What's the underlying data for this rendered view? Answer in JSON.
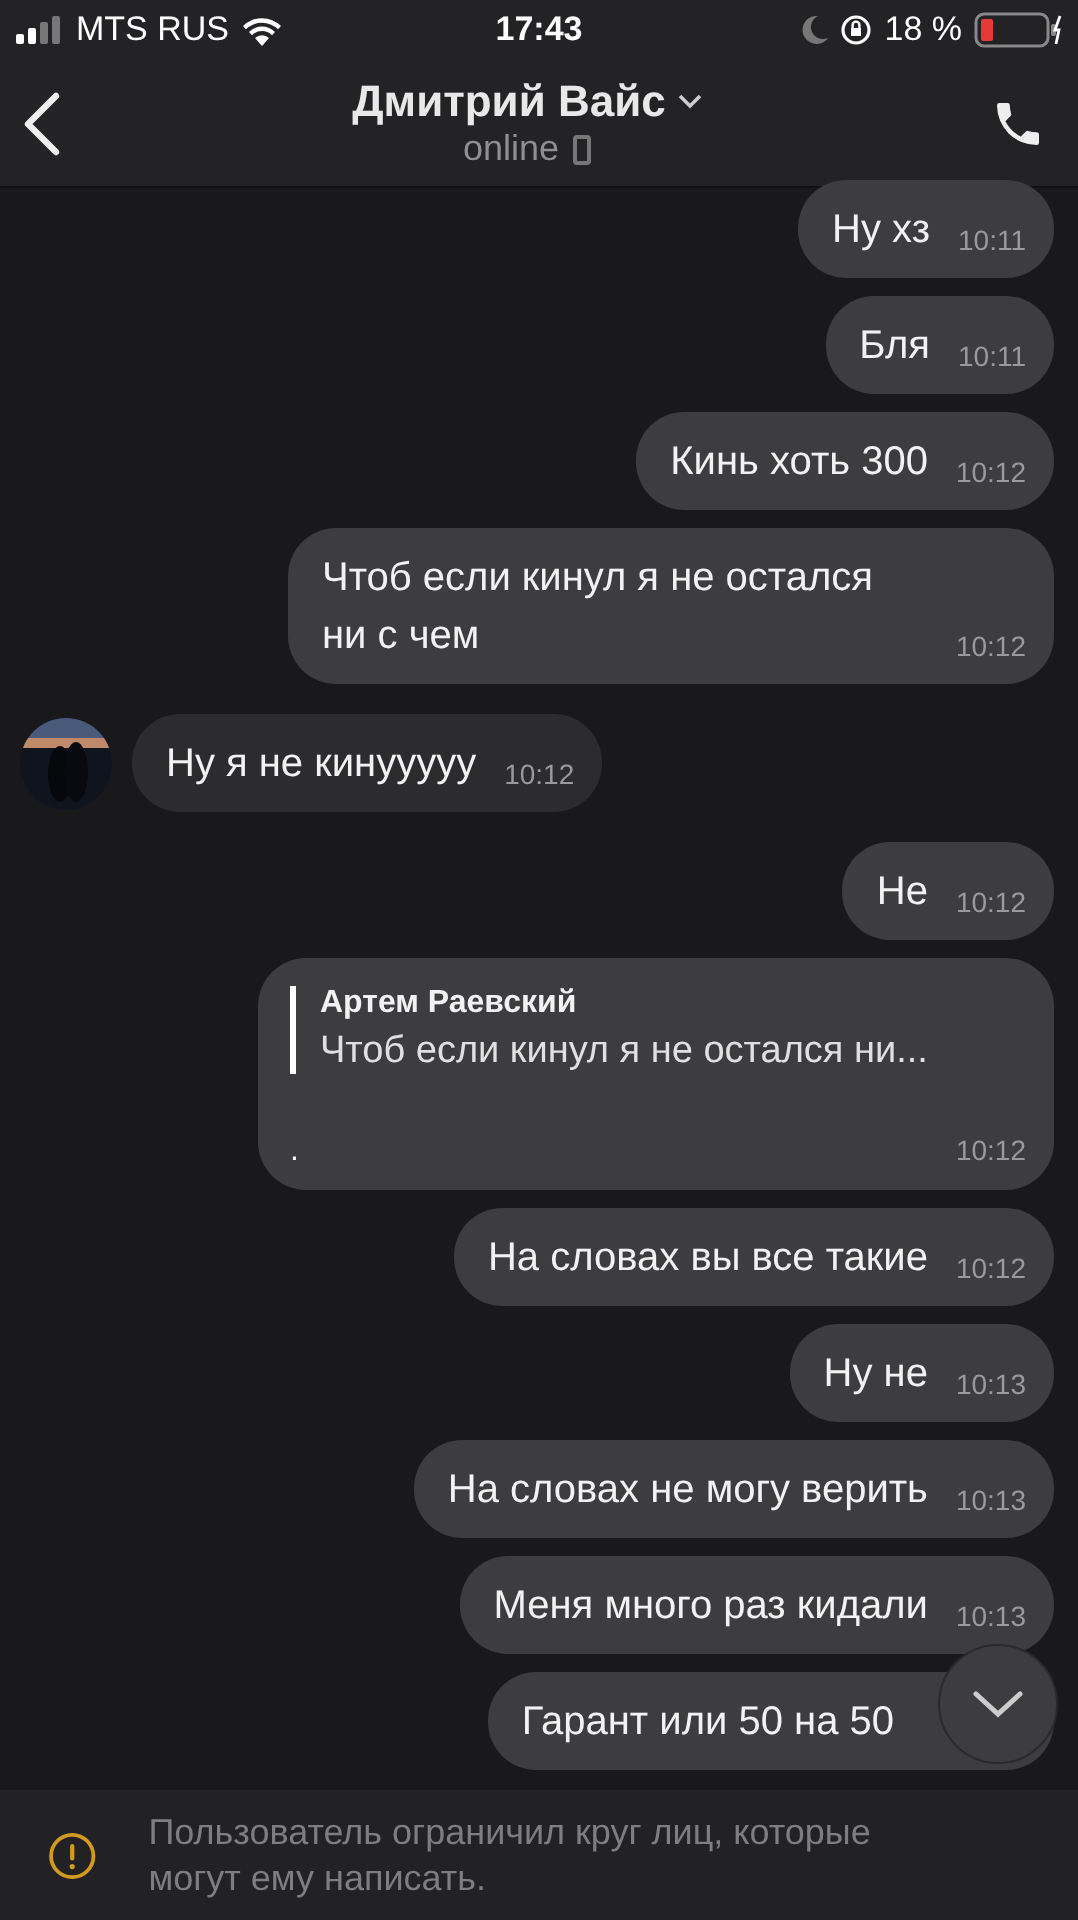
{
  "status_bar": {
    "carrier": "MTS RUS",
    "time": "17:43",
    "battery": "18 %"
  },
  "header": {
    "name": "Дмитрий Вайс",
    "status": "online"
  },
  "messages": [
    {
      "kind": "text",
      "incoming": false,
      "text": "Ну хз",
      "time": "10:11"
    },
    {
      "kind": "text",
      "incoming": false,
      "text": "Бля",
      "time": "10:11"
    },
    {
      "kind": "text",
      "incoming": false,
      "text": "Кинь хоть 300",
      "time": "10:12"
    },
    {
      "kind": "text",
      "incoming": false,
      "text": "Чтоб если кинул я не остался ни с чем",
      "time": "10:12"
    },
    {
      "kind": "text",
      "incoming": true,
      "text": "Ну я не кинууууу",
      "time": "10:12"
    },
    {
      "kind": "text",
      "incoming": false,
      "text": "Не",
      "time": "10:12"
    },
    {
      "kind": "reply",
      "incoming": false,
      "quote_author": "Артем Раевский",
      "quote_text": "Чтоб если кинул я не остался ни...",
      "text": ".",
      "time": "10:12"
    },
    {
      "kind": "text",
      "incoming": false,
      "text": "На словах вы все такие",
      "time": "10:12"
    },
    {
      "kind": "text",
      "incoming": false,
      "text": "Ну не",
      "time": "10:13"
    },
    {
      "kind": "text",
      "incoming": false,
      "text": "На словах не могу верить",
      "time": "10:13"
    },
    {
      "kind": "text",
      "incoming": false,
      "text": "Меня много раз кидали",
      "time": "10:13"
    },
    {
      "kind": "text",
      "incoming": false,
      "text": "Гарант или 50 на 50"
    }
  ],
  "notice": "Пользователь ограничил круг лиц, которые могут ему написать."
}
